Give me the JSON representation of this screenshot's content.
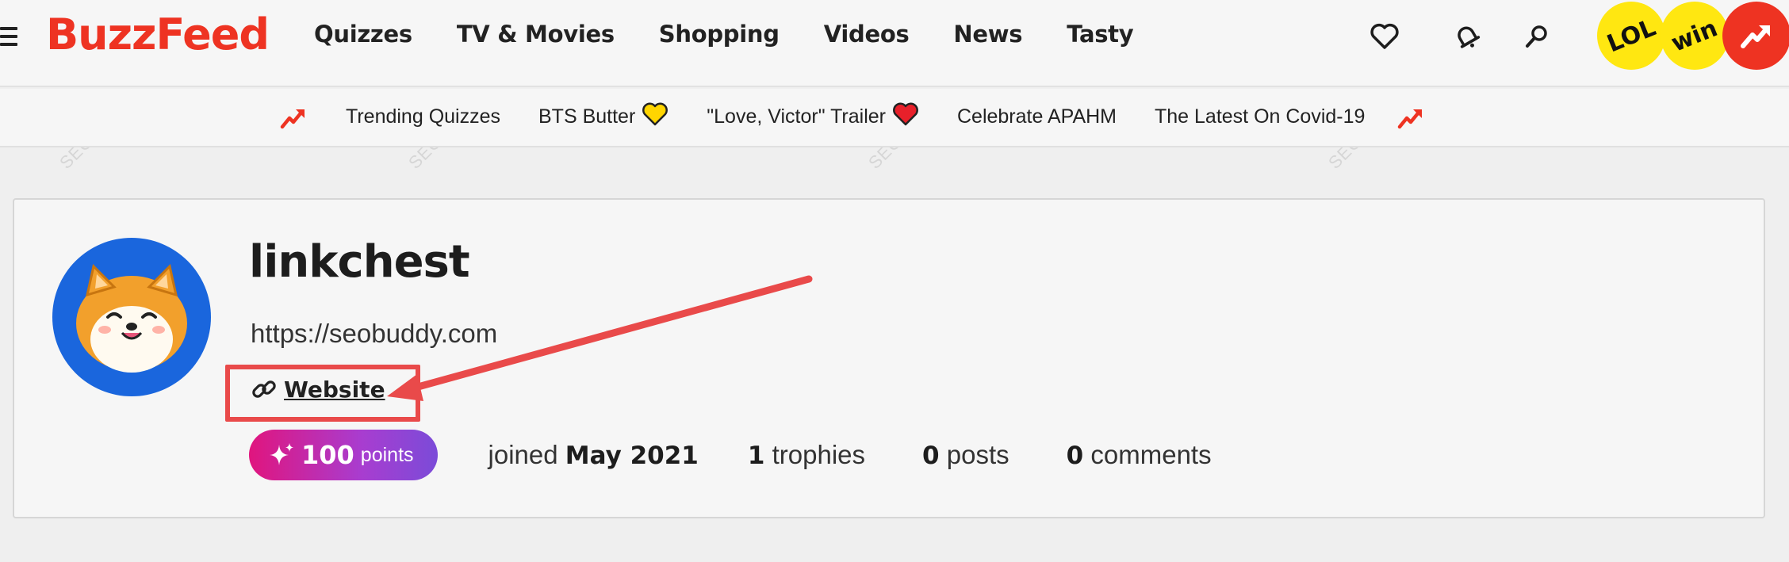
{
  "brand": {
    "logo": "BuzzFeed",
    "accent": "#ee3322"
  },
  "nav": {
    "links": [
      "Quizzes",
      "TV & Movies",
      "Shopping",
      "Videos",
      "News",
      "Tasty"
    ],
    "icons": [
      "heart-icon",
      "bell-icon",
      "search-icon"
    ],
    "badges": [
      "LOL",
      "win"
    ]
  },
  "trending": {
    "items": [
      {
        "label": "Trending Quizzes",
        "emoji": ""
      },
      {
        "label": "BTS Butter",
        "emoji": "💛"
      },
      {
        "label": "\"Love, Victor\" Trailer",
        "emoji": "❤️"
      },
      {
        "label": "Celebrate APAHM",
        "emoji": ""
      },
      {
        "label": "The Latest On Covid-19",
        "emoji": ""
      }
    ]
  },
  "profile": {
    "username": "linkchest",
    "bio": "https://seobuddy.com",
    "website_label": "Website",
    "points_value": "100",
    "points_unit": "points",
    "joined_label": "joined",
    "joined_date": "May 2021",
    "trophies_count": "1",
    "trophies_label": "trophies",
    "posts_count": "0",
    "posts_label": "posts",
    "comments_count": "0",
    "comments_label": "comments"
  },
  "watermark": "SEOBUDDY"
}
